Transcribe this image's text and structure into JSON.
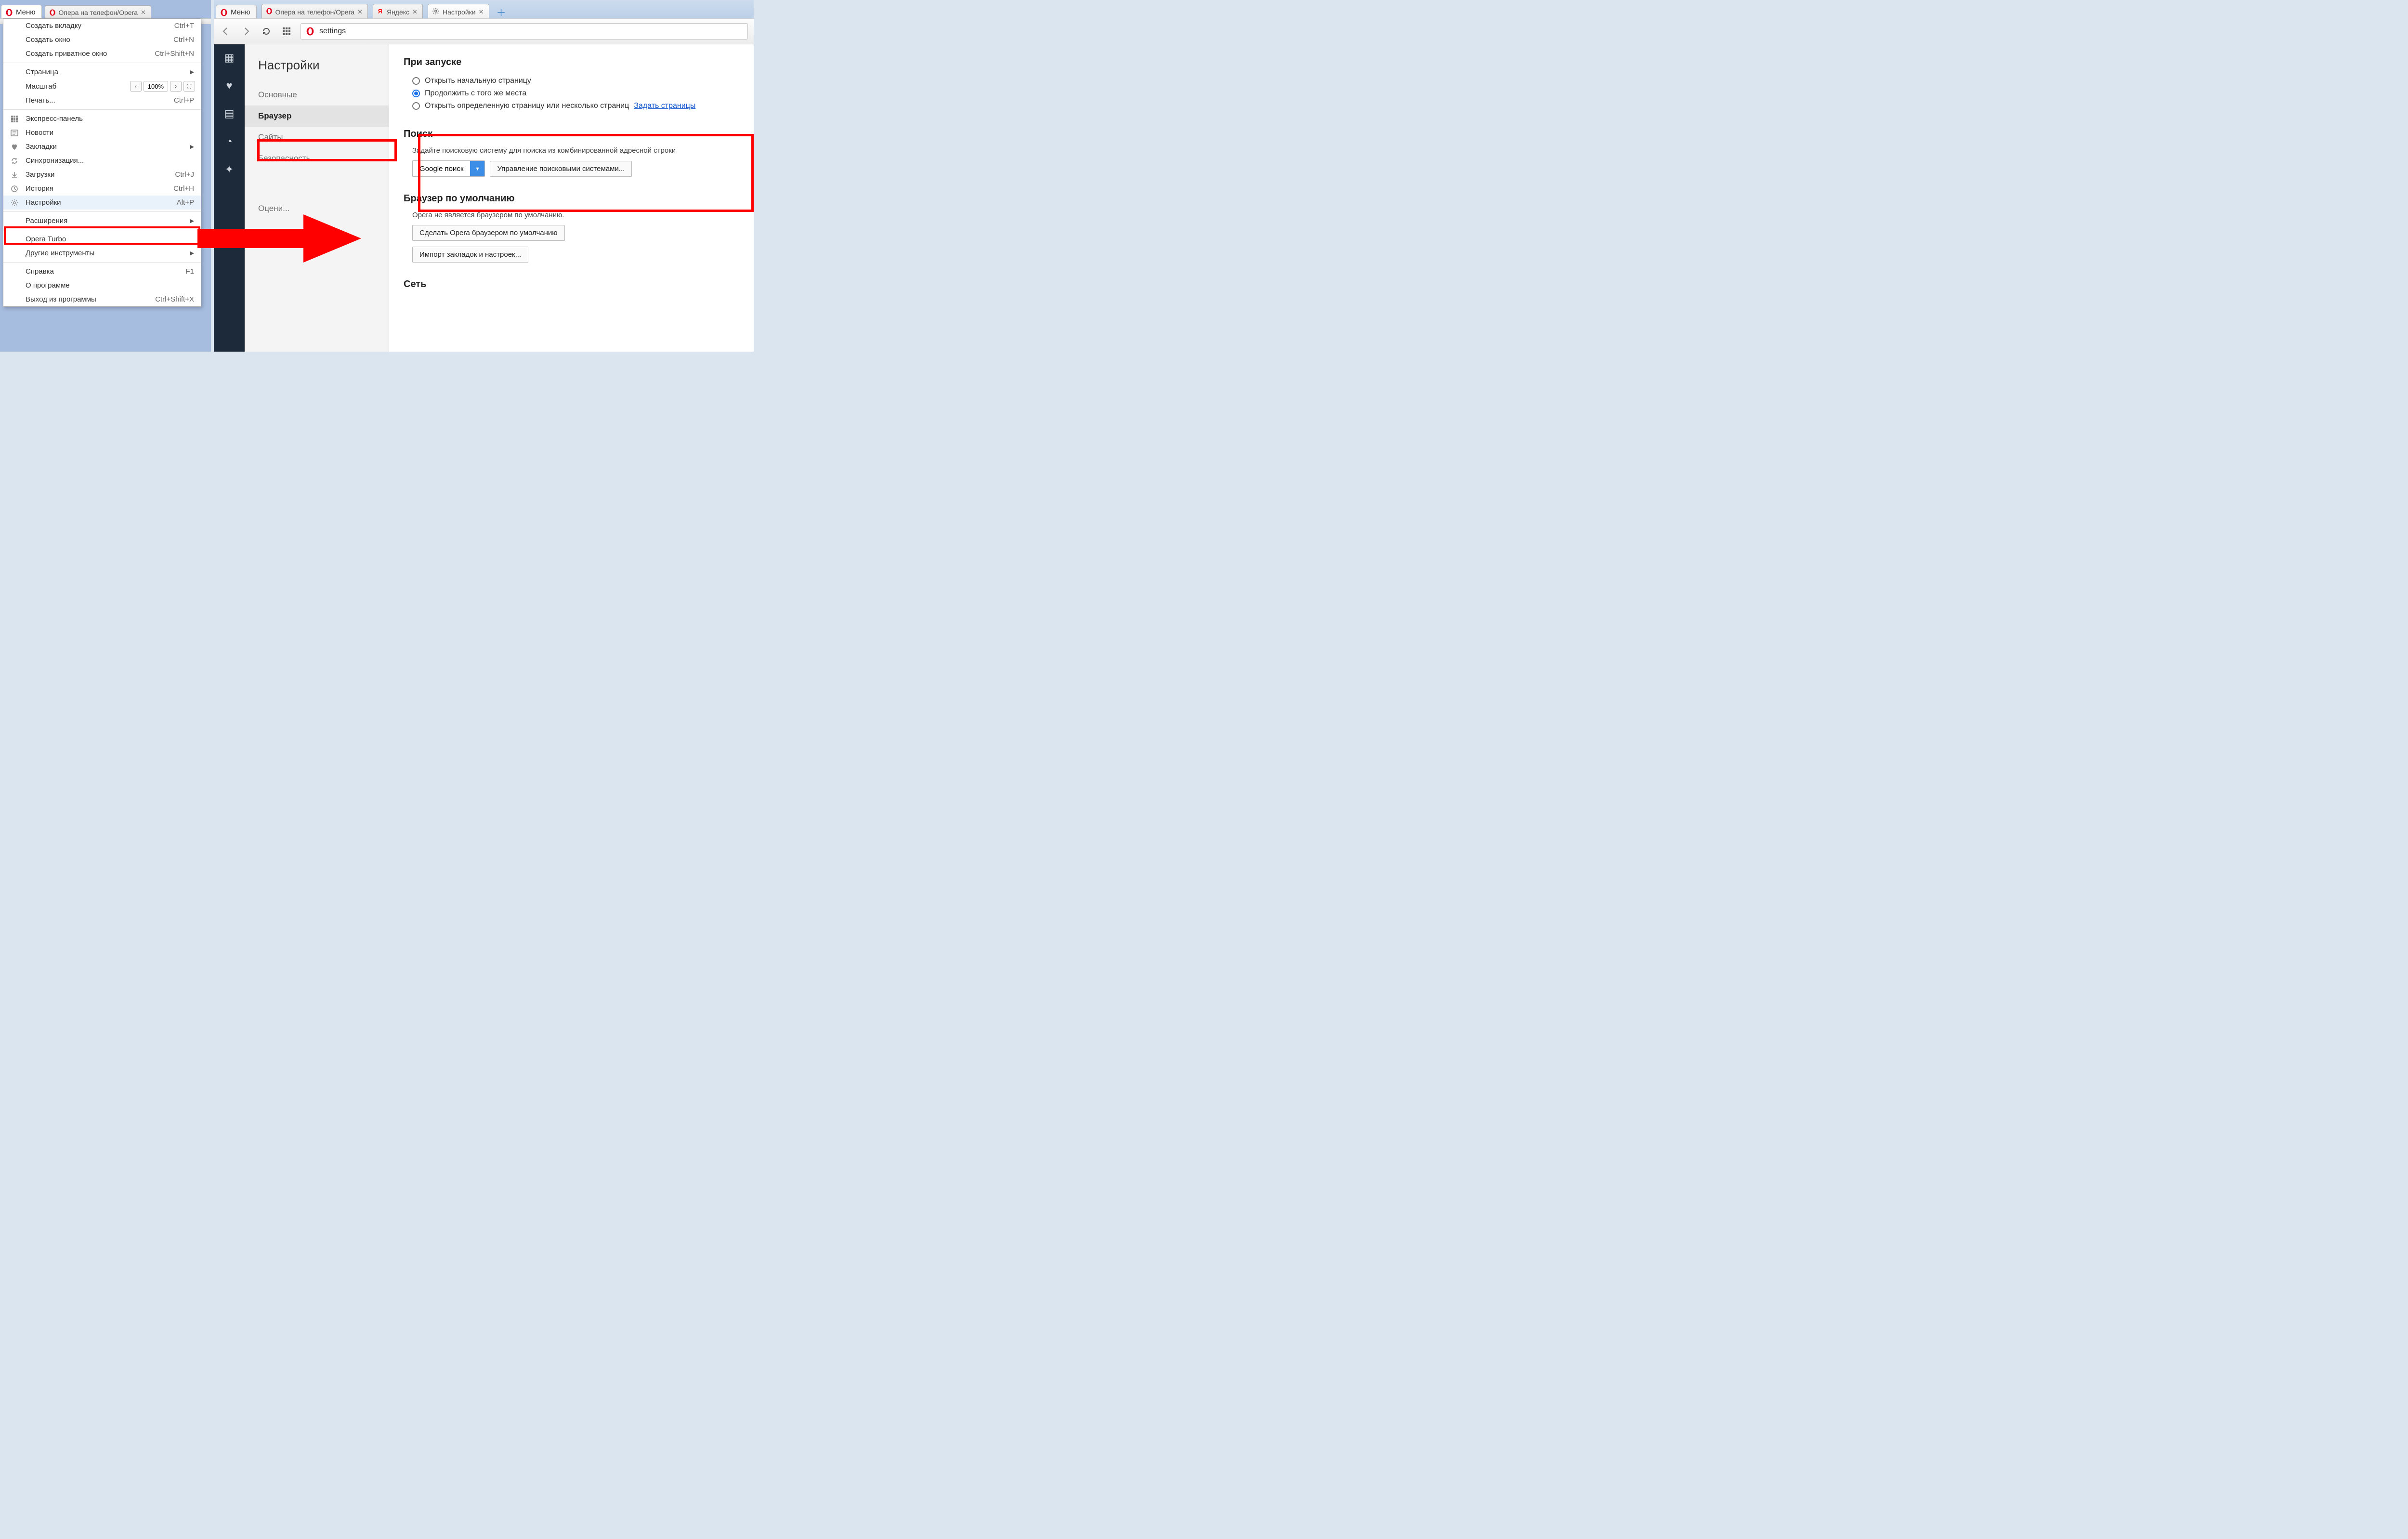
{
  "left": {
    "menu_button": "Меню",
    "tab_title": "Опера на телефон/Opera",
    "menu": [
      {
        "type": "item",
        "label": "Создать вкладку",
        "shortcut": "Ctrl+T"
      },
      {
        "type": "item",
        "label": "Создать окно",
        "shortcut": "Ctrl+N"
      },
      {
        "type": "item",
        "label": "Создать приватное окно",
        "shortcut": "Ctrl+Shift+N"
      },
      {
        "type": "sep"
      },
      {
        "type": "submenu",
        "label": "Страница"
      },
      {
        "type": "zoom",
        "label": "Масштаб",
        "value": "100%"
      },
      {
        "type": "item",
        "label": "Печать...",
        "shortcut": "Ctrl+P"
      },
      {
        "type": "sep"
      },
      {
        "type": "item",
        "label": "Экспресс-панель",
        "icon": "grid"
      },
      {
        "type": "item",
        "label": "Новости",
        "icon": "news"
      },
      {
        "type": "submenu",
        "label": "Закладки",
        "icon": "heart"
      },
      {
        "type": "item",
        "label": "Синхронизация...",
        "icon": "sync"
      },
      {
        "type": "item",
        "label": "Загрузки",
        "shortcut": "Ctrl+J",
        "icon": "download"
      },
      {
        "type": "item",
        "label": "История",
        "shortcut": "Ctrl+H",
        "icon": "history"
      },
      {
        "type": "item",
        "label": "Настройки",
        "shortcut": "Alt+P",
        "icon": "gear",
        "hover": true
      },
      {
        "type": "sep"
      },
      {
        "type": "submenu",
        "label": "Расширения"
      },
      {
        "type": "sep"
      },
      {
        "type": "item",
        "label": "Opera Turbo"
      },
      {
        "type": "submenu",
        "label": "Другие инструменты"
      },
      {
        "type": "sep"
      },
      {
        "type": "item",
        "label": "Справка",
        "shortcut": "F1"
      },
      {
        "type": "item",
        "label": "О программе"
      },
      {
        "type": "item",
        "label": "Выход из программы",
        "shortcut": "Ctrl+Shift+X"
      }
    ]
  },
  "right": {
    "menu_button": "Меню",
    "tabs": [
      {
        "title": "Опера на телефон/Opera",
        "icon": "opera"
      },
      {
        "title": "Яндекс",
        "icon": "yandex"
      },
      {
        "title": "Настройки",
        "icon": "gear",
        "active": true
      }
    ],
    "address": "settings",
    "sidebar": {
      "title": "Настройки",
      "items": [
        "Основные",
        "Браузер",
        "Сайты",
        "Безопасность",
        "",
        "Оцени..."
      ]
    },
    "sections": {
      "startup": {
        "title": "При запуске",
        "options": [
          {
            "label": "Открыть начальную страницу",
            "checked": false
          },
          {
            "label": "Продолжить с того же места",
            "checked": true
          },
          {
            "label": "Открыть определенную страницу или несколько страниц",
            "checked": false,
            "link": "Задать страницы"
          }
        ]
      },
      "search": {
        "title": "Поиск",
        "desc": "Задайте поисковую систему для поиска из комбинированной адресной строки",
        "select": "Google поиск",
        "manage_btn": "Управление поисковыми системами..."
      },
      "default_browser": {
        "title": "Браузер по умолчанию",
        "desc": "Opera не является браузером по умолчанию.",
        "make_default_btn": "Сделать Opera браузером по умолчанию",
        "import_btn": "Импорт закладок и настроек..."
      },
      "network": {
        "title": "Сеть"
      }
    }
  }
}
